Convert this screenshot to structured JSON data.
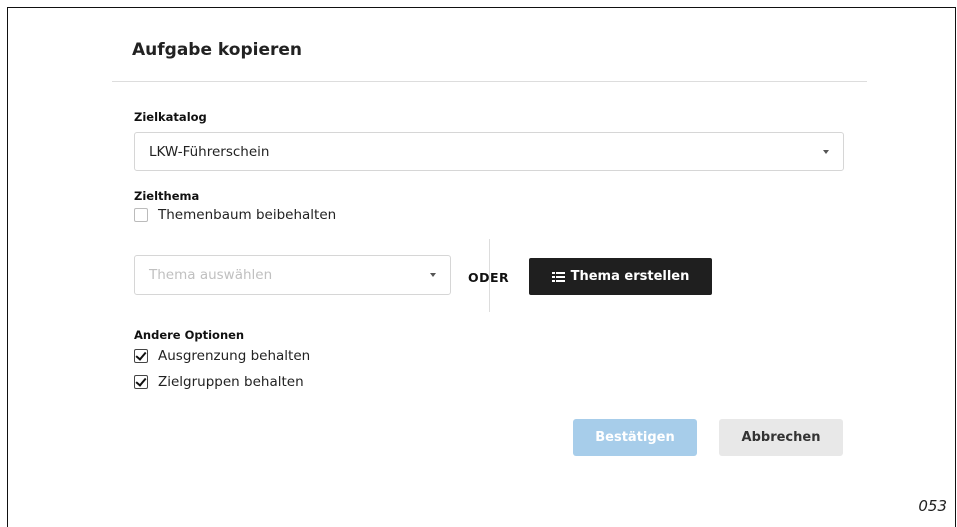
{
  "dialog": {
    "title": "Aufgabe kopieren",
    "target_catalog": {
      "label": "Zielkatalog",
      "selected": "LKW-Führerschein"
    },
    "target_topic": {
      "label": "Zielthema",
      "keep_tree_label": "Themenbaum beibehalten",
      "keep_tree_checked": false,
      "select_placeholder": "Thema auswählen",
      "or_label": "ODER",
      "create_label": "Thema erstellen"
    },
    "other_options": {
      "label": "Andere Optionen",
      "items": [
        {
          "label": "Ausgrenzung behalten",
          "checked": true
        },
        {
          "label": "Zielgruppen behalten",
          "checked": true
        }
      ]
    },
    "actions": {
      "confirm_label": "Bestätigen",
      "cancel_label": "Abbrechen"
    }
  },
  "page_number": "053",
  "colors": {
    "confirm_bg": "#a7cdea",
    "create_bg": "#1f1f1f",
    "cancel_bg": "#e8e8e8"
  },
  "icons": [
    "caret-down-icon",
    "list-icon",
    "checkmark-icon"
  ]
}
